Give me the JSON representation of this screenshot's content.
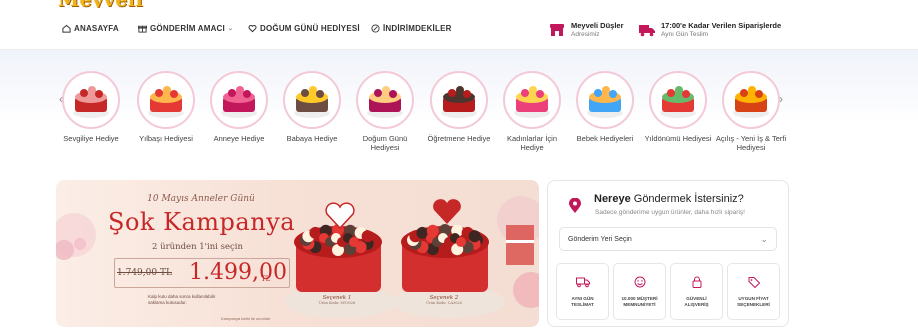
{
  "logo": {
    "text": "Meyveli Düşler"
  },
  "nav": {
    "items": [
      {
        "label": "ANASAYFA",
        "icon": "home-icon"
      },
      {
        "label": "GÖNDERİM AMACI",
        "icon": "gift-icon",
        "dropdown": true
      },
      {
        "label": "DOĞUM GÜNÜ HEDİYESİ",
        "icon": "heart-icon"
      },
      {
        "label": "İNDİRİMDEKİLER",
        "icon": "discount-icon"
      }
    ],
    "info": [
      {
        "title": "Meyveli Düşler",
        "sub": "Adresimiz",
        "icon": "store-icon"
      },
      {
        "title": "17:00'e Kadar Verilen Siparişlerde",
        "sub": "Aynı Gün Teslim",
        "icon": "truck-icon"
      }
    ]
  },
  "categories": [
    {
      "label": "Sevgiliye Hediye"
    },
    {
      "label": "Yılbaşı Hediyesi"
    },
    {
      "label": "Anneye Hediye"
    },
    {
      "label": "Babaya Hediye"
    },
    {
      "label": "Doğum Günü Hediyesi"
    },
    {
      "label": "Öğretmene Hediye"
    },
    {
      "label": "Kadınlarlar İçin Hediye"
    },
    {
      "label": "Bebek Hediyeleri"
    },
    {
      "label": "Yıldönümü Hediyesi"
    },
    {
      "label": "Açılış - Yeni İş & Terfi Hediyesi"
    }
  ],
  "banner": {
    "pretitle": "10 Mayıs Anneler Günü",
    "title": "Şok Kampanya",
    "subtitle": "2 üründen 1'ini seçin",
    "old_price": "1.749,00 TL",
    "new_price": "1.499,00",
    "currency": "TL",
    "note": "Kalp kutu daha sonra kullanılabilir saklama kutusudur.",
    "footnote": "Kampanya tarihi ile sınırlıdır",
    "product1": {
      "name": "Seçenek 1",
      "code": "Ürün Kodu: MY3026"
    },
    "product2": {
      "name": "Seçenek 2",
      "code": "Ürün Kodu: CA3026"
    }
  },
  "delivery": {
    "title_bold": "Nereye",
    "title_rest": " Göndermek İstersiniz?",
    "subtitle": "Sadece gönderime uygun ürünler, daha hızlı sipariş!",
    "select_placeholder": "Gönderim Yeri Seçin",
    "features": [
      {
        "label": "AYNI GÜN TESLİMAT",
        "icon": "truck-icon"
      },
      {
        "label": "10.000 MÜŞTERİ MEMNUNİYETİ",
        "icon": "smile-icon"
      },
      {
        "label": "GÜVENLİ ALIŞVERİŞ",
        "icon": "lock-icon"
      },
      {
        "label": "UYGUN FİYAT SEÇENEKLERİ",
        "icon": "tag-icon"
      }
    ]
  },
  "colors": {
    "accent": "#c2185b",
    "banner_red": "#c62828",
    "circle_border": "#f3c9d7"
  }
}
